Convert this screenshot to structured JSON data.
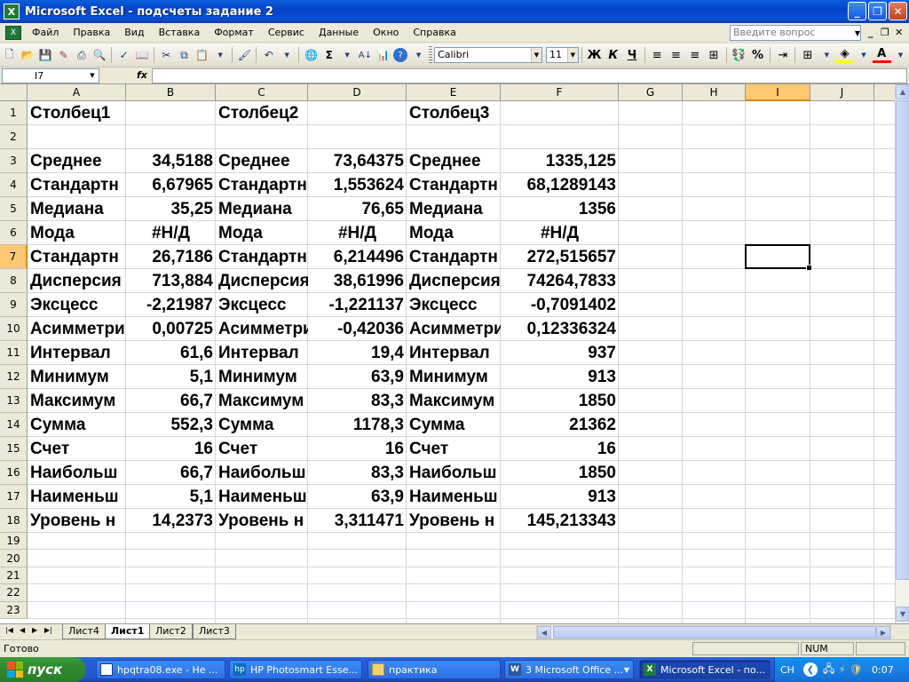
{
  "window": {
    "title": "Microsoft Excel - подсчеты задание 2",
    "minimize": "_",
    "restore": "❐",
    "close": "✕"
  },
  "menu": {
    "items": [
      {
        "label": "Файл"
      },
      {
        "label": "Правка"
      },
      {
        "label": "Вид"
      },
      {
        "label": "Вставка"
      },
      {
        "label": "Формат"
      },
      {
        "label": "Сервис"
      },
      {
        "label": "Данные"
      },
      {
        "label": "Окно"
      },
      {
        "label": "Справка"
      }
    ],
    "help_placeholder": "Введите вопрос"
  },
  "toolbar": {
    "font_name": "Calibri",
    "font_size": "11",
    "bold": "Ж",
    "italic": "К",
    "underline": "Ч",
    "percent": "%",
    "sigma": "Σ",
    "font_color_letter": "A"
  },
  "formula_bar": {
    "name_box": "I7",
    "fx": "fx",
    "content": ""
  },
  "columns": [
    "A",
    "B",
    "C",
    "D",
    "E",
    "F",
    "G",
    "H",
    "I",
    "J"
  ],
  "rows": [
    "1",
    "2",
    "3",
    "4",
    "5",
    "6",
    "7",
    "8",
    "9",
    "10",
    "11",
    "12",
    "13",
    "14",
    "15",
    "16",
    "17",
    "18",
    "19",
    "20",
    "21",
    "22",
    "23"
  ],
  "cells": {
    "r1": {
      "a": "Столбец1",
      "c": "Столбец2",
      "e": "Столбец3"
    },
    "r3": {
      "a": "Среднее",
      "b": "34,5188",
      "c": "Среднее",
      "d": "73,64375",
      "e": "Среднее",
      "f": "1335,125"
    },
    "r4": {
      "a": "Стандартн",
      "b": "6,67965",
      "c": "Стандартн",
      "d": "1,553624",
      "e": "Стандартн",
      "f": "68,1289143"
    },
    "r5": {
      "a": "Медиана",
      "b": "35,25",
      "c": "Медиана",
      "d": "76,65",
      "e": "Медиана",
      "f": "1356"
    },
    "r6": {
      "a": "Мода",
      "b": "#Н/Д",
      "c": "Мода",
      "d": "#Н/Д",
      "e": "Мода",
      "f": "#Н/Д"
    },
    "r7": {
      "a": "Стандартн",
      "b": "26,7186",
      "c": "Стандартн",
      "d": "6,214496",
      "e": "Стандартн",
      "f": "272,515657"
    },
    "r8": {
      "a": "Дисперсия",
      "b": "713,884",
      "c": "Дисперсия",
      "d": "38,61996",
      "e": "Дисперсия",
      "f": "74264,7833"
    },
    "r9": {
      "a": "Эксцесс",
      "b": "-2,21987",
      "c": "Эксцесс",
      "d": "-1,221137",
      "e": "Эксцесс",
      "f": "-0,7091402"
    },
    "r10": {
      "a": "Асимметри",
      "b": "0,00725",
      "c": "Асимметри",
      "d": "-0,42036",
      "e": "Асимметри",
      "f": "0,12336324"
    },
    "r11": {
      "a": "Интервал",
      "b": "61,6",
      "c": "Интервал",
      "d": "19,4",
      "e": "Интервал",
      "f": "937"
    },
    "r12": {
      "a": "Минимум",
      "b": "5,1",
      "c": "Минимум",
      "d": "63,9",
      "e": "Минимум",
      "f": "913"
    },
    "r13": {
      "a": "Максимум",
      "b": "66,7",
      "c": "Максимум",
      "d": "83,3",
      "e": "Максимум",
      "f": "1850"
    },
    "r14": {
      "a": "Сумма",
      "b": "552,3",
      "c": "Сумма",
      "d": "1178,3",
      "e": "Сумма",
      "f": "21362"
    },
    "r15": {
      "a": "Счет",
      "b": "16",
      "c": "Счет",
      "d": "16",
      "e": "Счет",
      "f": "16"
    },
    "r16": {
      "a": "Наибольш",
      "b": "66,7",
      "c": "Наибольш",
      "d": "83,3",
      "e": "Наибольш",
      "f": "1850"
    },
    "r17": {
      "a": "Наименьш",
      "b": "5,1",
      "c": "Наименьш",
      "d": "63,9",
      "e": "Наименьш",
      "f": "913"
    },
    "r18": {
      "a": "Уровень н",
      "b": "14,2373",
      "c": "Уровень н",
      "d": "3,311471",
      "e": "Уровень н",
      "f": "145,213343"
    }
  },
  "sheets": {
    "tabs": [
      {
        "label": "Лист4"
      },
      {
        "label": "Лист1"
      },
      {
        "label": "Лист2"
      },
      {
        "label": "Лист3"
      }
    ],
    "active": "Лист1"
  },
  "status": {
    "text": "Готово",
    "num": "NUM"
  },
  "taskbar": {
    "start": "пуск",
    "tasks": [
      {
        "label": "hpqtra08.exe - Не ..."
      },
      {
        "label": "HP Photosmart Esse..."
      },
      {
        "label": "практика"
      },
      {
        "label": "3 Microsoft Office ..."
      },
      {
        "label": "Microsoft Excel - по..."
      }
    ],
    "lang": "CH",
    "clock": "0:07"
  },
  "colors": {
    "selection_header": "#ffc873",
    "gridline": "#d0d7e5",
    "title_bar": "#0a4fd4",
    "start_button": "#2f8a2f"
  }
}
